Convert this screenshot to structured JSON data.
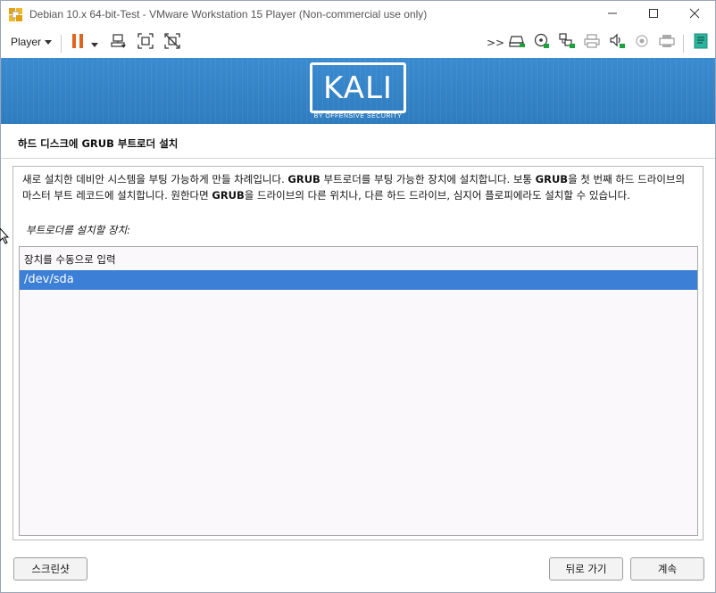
{
  "window": {
    "title": "Debian 10.x 64-bit-Test - VMware Workstation 15 Player (Non-commercial use only)",
    "controls": [
      "minimize-icon",
      "maximize-icon",
      "close-icon"
    ]
  },
  "toolbar": {
    "player_label": "Player",
    "left_icons": [
      "pause-icon",
      "dropdown-arrow-icon",
      "send-ctrl-alt-del-icon",
      "fit-guest-icon",
      "unity-icon"
    ],
    "device_icons": [
      "more-devices-icon",
      "hard-disk-icon",
      "cd-dvd-icon",
      "network-adapter-icon",
      "printer-icon",
      "sound-card-icon",
      "camera-icon",
      "usb-device-icon",
      "message-log-icon"
    ]
  },
  "banner": {
    "logo_text": "KALI",
    "logo_subtitle": "BY OFFENSIVE SECURITY",
    "background_color": "#3683c5"
  },
  "installer": {
    "heading": "하드 디스크에 GRUB 부트로더 설치",
    "description_parts": [
      "새로 설치한 데비안 시스템을 부팅 가능하게 만들 차례입니다. ",
      "GRUB",
      " 부트로더를 부팅 가능한 장치에 설치합니다. 보통 ",
      "GRUB",
      "을 첫 번째 하드 드라이브의 마스터 부트 레코드에 설치합니다. 원한다면 ",
      "GRUB",
      "을 드라이브의 다른 위치나, 다른 하드 드라이브, 심지어 플로피에라도 설치할 수 있습니다."
    ],
    "prompt": "부트로더를 설치할 장치:",
    "devices": [
      {
        "label": "장치를 수동으로 입력",
        "selected": false
      },
      {
        "label": "/dev/sda",
        "selected": true
      }
    ],
    "selection_color": "#3c7fd6",
    "buttons": {
      "screenshot": "스크린샷",
      "back": "뒤로 가기",
      "continue": "계속"
    }
  }
}
